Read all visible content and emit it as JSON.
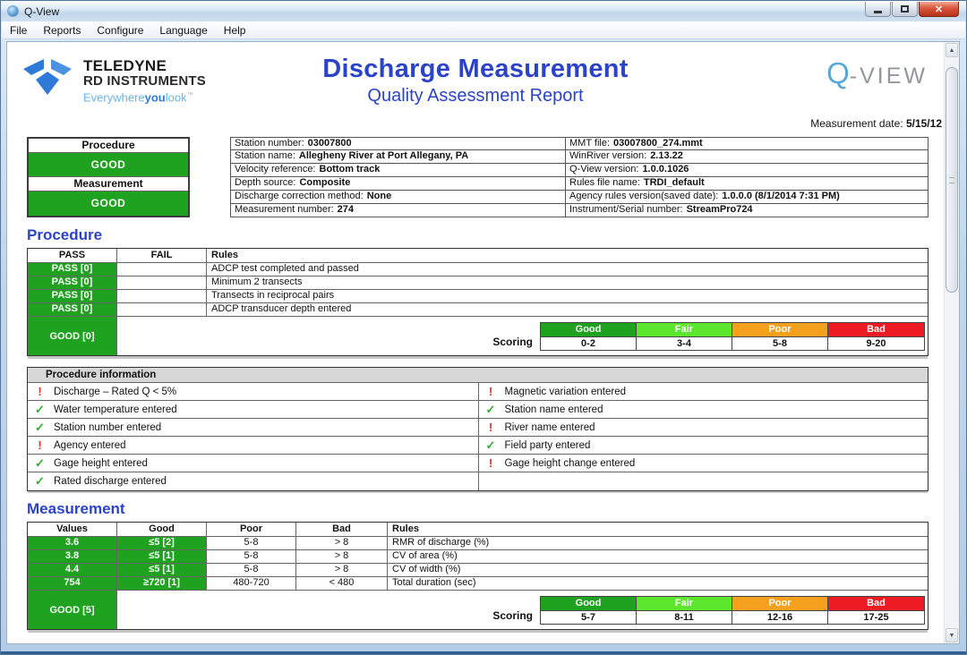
{
  "window": {
    "title": "Q-View"
  },
  "menu": {
    "items": [
      "File",
      "Reports",
      "Configure",
      "Language",
      "Help"
    ]
  },
  "icons": {
    "scroll_up": "▲",
    "scroll_down": "▼",
    "close": "✕",
    "check": "✓",
    "warning": "!"
  },
  "colors": {
    "good": "#1fa21f",
    "fair": "#5ce62e",
    "poor": "#f6a11d",
    "bad": "#ed1c24",
    "accent": "#2b43c8"
  },
  "header": {
    "logo_line1": "TELEDYNE",
    "logo_line2": "RD INSTRUMENTS",
    "tagline_a": "Everywhere",
    "tagline_b": "you",
    "tagline_c": "look",
    "tagline_tm": "™",
    "title": "Discharge Measurement",
    "subtitle": "Quality Assessment Report",
    "brand_q": "Q",
    "brand_rest": "-VIEW",
    "date_label": "Measurement date:",
    "date_value": "5/15/12"
  },
  "summary": {
    "status": [
      {
        "label": "Procedure",
        "value": "GOOD"
      },
      {
        "label": "Measurement",
        "value": "GOOD"
      }
    ],
    "info_left": [
      {
        "label": "Station number:",
        "value": "03007800"
      },
      {
        "label": "Station name:",
        "value": "Allegheny River at Port Allegany, PA"
      },
      {
        "label": "Velocity reference:",
        "value": "Bottom track"
      },
      {
        "label": "Depth source:",
        "value": "Composite"
      },
      {
        "label": "Discharge correction method:",
        "value": "None"
      },
      {
        "label": "Measurement number:",
        "value": "274"
      }
    ],
    "info_right": [
      {
        "label": "MMT file:",
        "value": "03007800_274.mmt"
      },
      {
        "label": "WinRiver version:",
        "value": "2.13.22"
      },
      {
        "label": "Q-View version:",
        "value": "1.0.0.1026"
      },
      {
        "label": "Rules file name:",
        "value": "TRDI_default"
      },
      {
        "label": "Agency rules version(saved date):",
        "value": "1.0.0.0 (8/1/2014 7:31 PM)"
      },
      {
        "label": "Instrument/Serial number:",
        "value": "StreamPro724"
      }
    ]
  },
  "procedure": {
    "heading": "Procedure",
    "table": {
      "headers": [
        "PASS",
        "FAIL",
        "Rules"
      ],
      "rows": [
        {
          "pass": "PASS [0]",
          "fail": "",
          "rule": "ADCP test completed and passed"
        },
        {
          "pass": "PASS [0]",
          "fail": "",
          "rule": "Minimum 2 transects"
        },
        {
          "pass": "PASS [0]",
          "fail": "",
          "rule": "Transects in reciprocal pairs"
        },
        {
          "pass": "PASS [0]",
          "fail": "",
          "rule": "ADCP transducer depth entered"
        }
      ]
    },
    "overall": "GOOD [0]",
    "scoring_label": "Scoring",
    "scoring": {
      "bands": [
        {
          "label": "Good",
          "range": "0-2",
          "color": "#1fa21f"
        },
        {
          "label": "Fair",
          "range": "3-4",
          "color": "#5ce62e"
        },
        {
          "label": "Poor",
          "range": "5-8",
          "color": "#f6a11d"
        },
        {
          "label": "Bad",
          "range": "9-20",
          "color": "#ed1c24"
        }
      ]
    }
  },
  "procedure_information": {
    "heading": "Procedure information",
    "items_left": [
      {
        "status": "warning",
        "text": "Discharge – Rated Q < 5%"
      },
      {
        "status": "ok",
        "text": "Water temperature entered"
      },
      {
        "status": "ok",
        "text": "Station number entered"
      },
      {
        "status": "warning",
        "text": "Agency entered"
      },
      {
        "status": "ok",
        "text": "Gage height entered"
      },
      {
        "status": "ok",
        "text": "Rated discharge entered"
      }
    ],
    "items_right": [
      {
        "status": "warning",
        "text": "Magnetic variation entered"
      },
      {
        "status": "ok",
        "text": "Station name entered"
      },
      {
        "status": "warning",
        "text": "River name entered"
      },
      {
        "status": "ok",
        "text": "Field party entered"
      },
      {
        "status": "warning",
        "text": "Gage height change entered"
      },
      {
        "status": "none",
        "text": ""
      }
    ]
  },
  "measurement": {
    "heading": "Measurement",
    "table": {
      "headers": [
        "Values",
        "Good",
        "Poor",
        "Bad",
        "Rules"
      ],
      "rows": [
        {
          "value": "3.6",
          "good": "≤5 [2]",
          "poor": "5-8",
          "bad": "> 8",
          "rule": "RMR of discharge (%)"
        },
        {
          "value": "3.8",
          "good": "≤5 [1]",
          "poor": "5-8",
          "bad": "> 8",
          "rule": "CV of area (%)"
        },
        {
          "value": "4.4",
          "good": "≤5 [1]",
          "poor": "5-8",
          "bad": "> 8",
          "rule": "CV of width (%)"
        },
        {
          "value": "754",
          "good": "≥720 [1]",
          "poor": "480-720",
          "bad": "< 480",
          "rule": "Total duration (sec)"
        }
      ]
    },
    "overall": "GOOD [5]",
    "scoring_label": "Scoring",
    "scoring": {
      "bands": [
        {
          "label": "Good",
          "range": "5-7",
          "color": "#1fa21f"
        },
        {
          "label": "Fair",
          "range": "8-11",
          "color": "#5ce62e"
        },
        {
          "label": "Poor",
          "range": "12-16",
          "color": "#f6a11d"
        },
        {
          "label": "Bad",
          "range": "17-25",
          "color": "#ed1c24"
        }
      ]
    }
  }
}
